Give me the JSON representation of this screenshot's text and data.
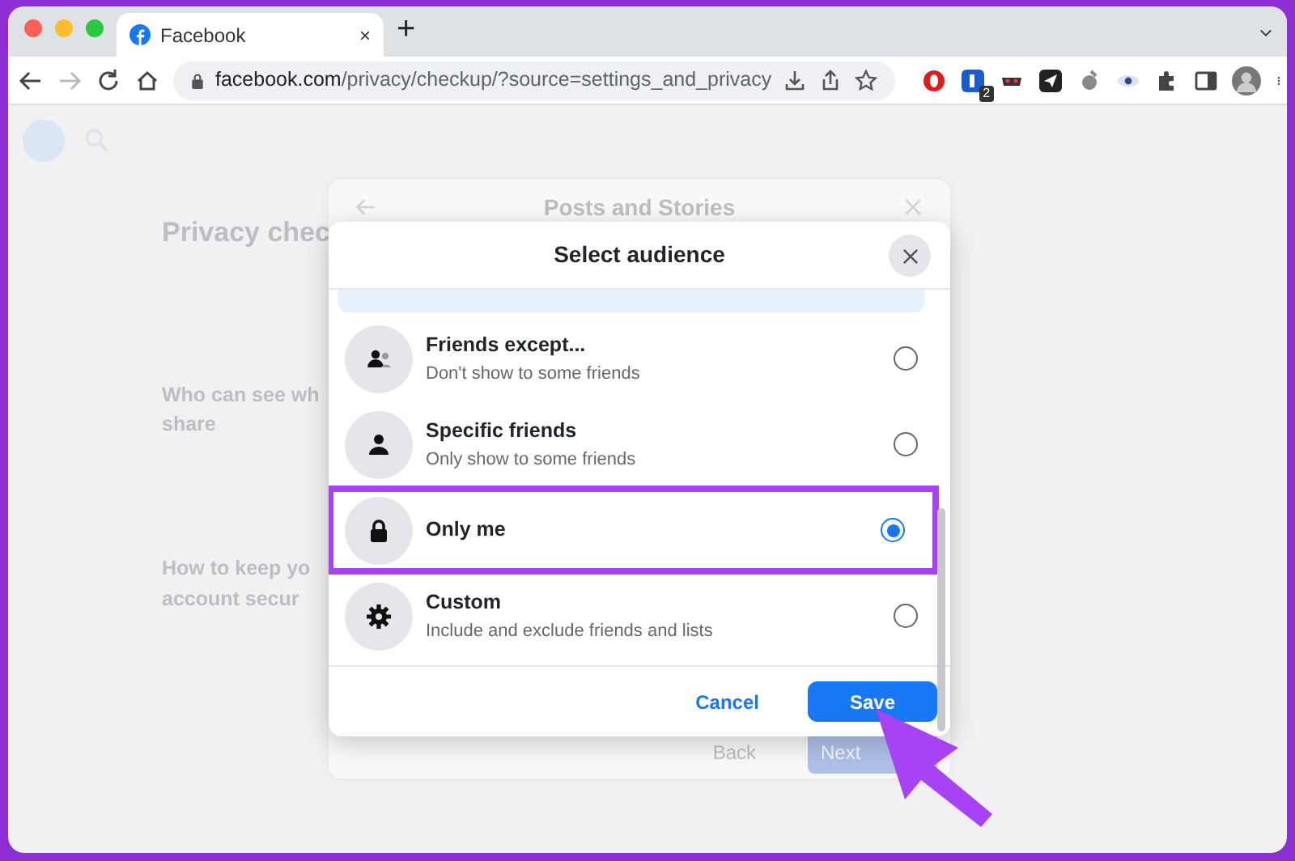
{
  "browser": {
    "tab": {
      "title": "Facebook",
      "close": "×",
      "new_tab": "+"
    },
    "url": {
      "host": "facebook.com",
      "path": "/privacy/checkup/?source=settings_and_privacy"
    },
    "extension_badge": "2"
  },
  "background_page": {
    "title": "Privacy chec",
    "cards": [
      {
        "lines": [
          "Who can see wh",
          "share"
        ]
      },
      {
        "lines": [
          "How to keep yo",
          "account secur"
        ]
      }
    ],
    "dialog_title": "Posts and Stories",
    "buttons": [
      "Back",
      "Next"
    ]
  },
  "modal": {
    "title": "Select audience",
    "options": [
      {
        "kind": "friends",
        "label": "Friends except...",
        "description": "Don't show to some friends",
        "selected": false,
        "highlighted": false
      },
      {
        "kind": "person",
        "label": "Specific friends",
        "description": "Only show to some friends",
        "selected": false,
        "highlighted": false
      },
      {
        "kind": "lock",
        "label": "Only me",
        "selected": true,
        "highlighted": true
      },
      {
        "kind": "gear",
        "label": "Custom",
        "description": "Include and exclude friends and lists",
        "selected": false,
        "highlighted": false
      }
    ],
    "cancel": "Cancel",
    "save": "Save"
  }
}
